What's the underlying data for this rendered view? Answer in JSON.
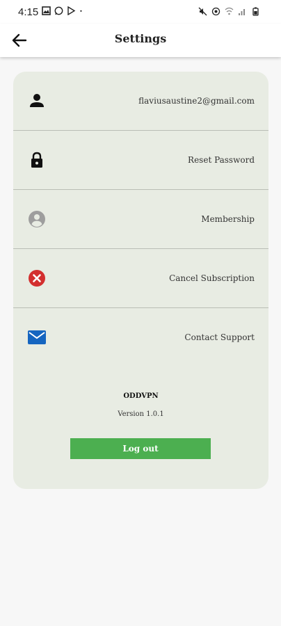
{
  "status_bar": {
    "time": "4:15",
    "left_icons": [
      "gallery-icon",
      "whatsapp-icon",
      "play-store-icon",
      "dot-icon"
    ],
    "right_icons": [
      "mute-icon",
      "hotspot-icon",
      "wifi-icon",
      "signal-icon",
      "battery-icon"
    ]
  },
  "header": {
    "title": "Settings",
    "back_icon": "arrow-left-icon"
  },
  "settings_items": [
    {
      "label": "flaviusaustine2@gmail.com",
      "icon": "person-icon"
    },
    {
      "label": "Reset Password",
      "icon": "lock-icon"
    },
    {
      "label": "Membership",
      "icon": "account-circle-icon"
    },
    {
      "label": "Cancel Subscription",
      "icon": "cancel-icon"
    },
    {
      "label": "Contact Support",
      "icon": "mail-icon"
    }
  ],
  "footer": {
    "app_name": "ODDVPN",
    "version": "Version 1.0.1",
    "logout_label": "Log out"
  },
  "colors": {
    "card_bg": "#e8ece3",
    "logout_bg": "#4caf50",
    "cancel_icon": "#d32f2f",
    "mail_icon": "#1565c0",
    "membership_icon": "#9e9e9e"
  }
}
